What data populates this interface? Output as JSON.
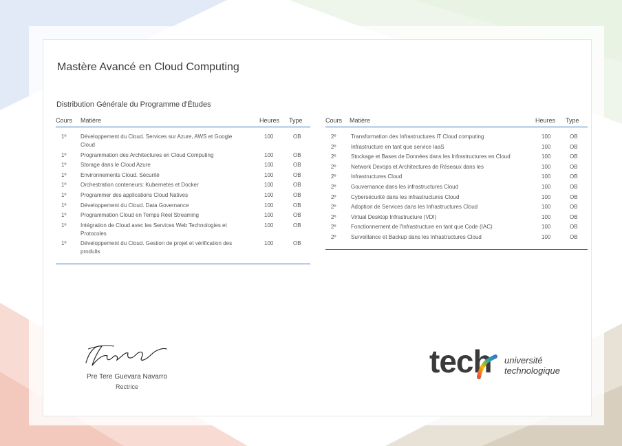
{
  "document": {
    "title": "Mastère Avancé en Cloud Computing",
    "subtitle": "Distribution Générale du Programme d'Études"
  },
  "table_headers": {
    "cours": "Cours",
    "matiere": "Matière",
    "heures": "Heures",
    "type": "Type"
  },
  "left_rows": [
    {
      "cours": "1º",
      "matiere": "Développement du Cloud. Services sur Azure, AWS et Google Cloud",
      "heures": "100",
      "type": "OB"
    },
    {
      "cours": "1º",
      "matiere": "Programmation des Architectures en Cloud Computing",
      "heures": "100",
      "type": "OB"
    },
    {
      "cours": "1º",
      "matiere": "Storage dans le Cloud Azure",
      "heures": "100",
      "type": "OB"
    },
    {
      "cours": "1º",
      "matiere": "Environnements Cloud. Sécurité",
      "heures": "100",
      "type": "OB"
    },
    {
      "cours": "1º",
      "matiere": "Orchestration conteneurs: Kubernetes et Docker",
      "heures": "100",
      "type": "OB"
    },
    {
      "cours": "1º",
      "matiere": "Programmer des applications Cloud Natives",
      "heures": "100",
      "type": "OB"
    },
    {
      "cours": "1º",
      "matiere": "Développement du Cloud. Data Governance",
      "heures": "100",
      "type": "OB"
    },
    {
      "cours": "1º",
      "matiere": "Programmation Cloud en Temps Réel Streaming",
      "heures": "100",
      "type": "OB"
    },
    {
      "cours": "1º",
      "matiere": "Intégration de Cloud avec les Services Web Technologies et Protocoles",
      "heures": "100",
      "type": "OB"
    },
    {
      "cours": "1º",
      "matiere": "Développement du Cloud. Gestion de projet et vérification des produits",
      "heures": "100",
      "type": "OB"
    }
  ],
  "right_rows": [
    {
      "cours": "2º",
      "matiere": "Transformation des Infrastructures IT Cloud computing",
      "heures": "100",
      "type": "OB"
    },
    {
      "cours": "2º",
      "matiere": "Infrastructure en tant que service IaaS",
      "heures": "100",
      "type": "OB"
    },
    {
      "cours": "2º",
      "matiere": "Stockage et Bases de Données dans les Infrastructures en Cloud",
      "heures": "100",
      "type": "OB"
    },
    {
      "cours": "2º",
      "matiere": "Network Devops et Architectures de Réseaux dans les",
      "heures": "100",
      "type": "OB"
    },
    {
      "cours": "2º",
      "matiere": "Infrastructures Cloud",
      "heures": "100",
      "type": "OB"
    },
    {
      "cours": "2º",
      "matiere": "Gouvernance dans les infrastructures Cloud",
      "heures": "100",
      "type": "OB"
    },
    {
      "cours": "2º",
      "matiere": "Cybersécurité dans les infrastructures Cloud",
      "heures": "100",
      "type": "OB"
    },
    {
      "cours": "2º",
      "matiere": "Adoption de Services dans les Infrastructures Cloud",
      "heures": "100",
      "type": "OB"
    },
    {
      "cours": "2º",
      "matiere": "Virtual Desktop Infrastructure (VDI)",
      "heures": "100",
      "type": "OB"
    },
    {
      "cours": "2º",
      "matiere": "Fonctionnement de l'Infrastructure en tant que Code (IAC)",
      "heures": "100",
      "type": "OB"
    },
    {
      "cours": "2º",
      "matiere": "Surveillance et Backup dans les Infrastructures Cloud",
      "heures": "100",
      "type": "OB"
    }
  ],
  "signature": {
    "name": "Pre Tere Guevara Navarro",
    "role": "Rectrice"
  },
  "logo": {
    "wordmark": "tech",
    "line1": "université",
    "line2": "technologique"
  },
  "colors": {
    "accent_line": "#2f6fb3",
    "logo_gradient": [
      "#e94e3c",
      "#f5b800",
      "#27a6a0",
      "#3a78c9"
    ]
  }
}
